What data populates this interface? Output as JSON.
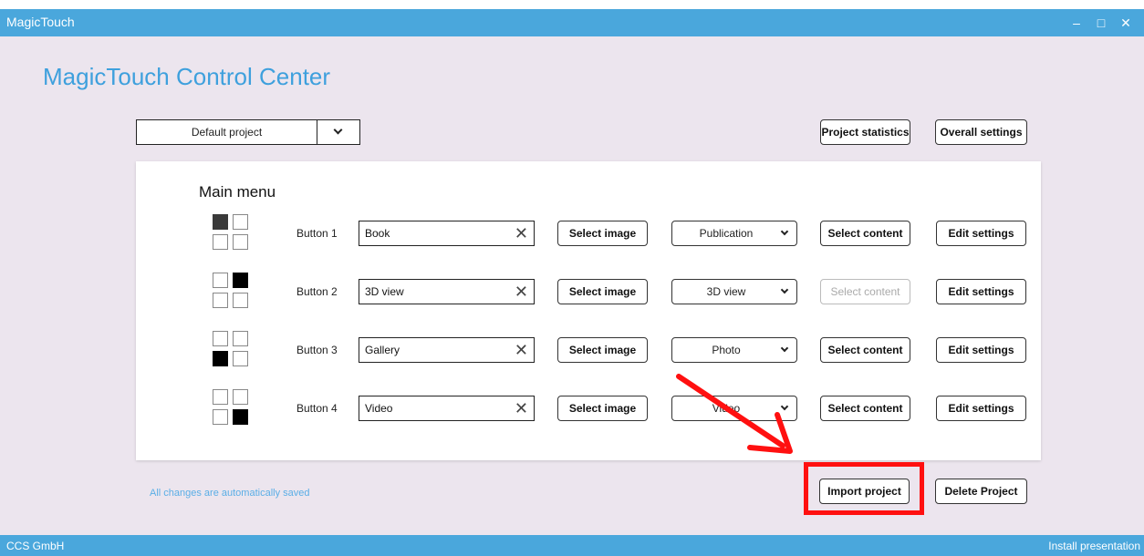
{
  "window": {
    "title": "MagicTouch",
    "controls": {
      "minimize": "–",
      "maximize": "□",
      "close": "✕"
    }
  },
  "heading": "MagicTouch Control Center",
  "project_select": {
    "value": "Default project",
    "icon": "chevron-down-icon"
  },
  "top_buttons": {
    "statistics": "Project statistics",
    "overall_settings": "Overall settings"
  },
  "panel": {
    "title": "Main menu",
    "rows": [
      {
        "label": "Button 1",
        "name": "Book",
        "select_image": "Select image",
        "type": "Publication",
        "select_content": "Select content",
        "select_content_enabled": true,
        "edit": "Edit settings",
        "clear_icon": "✕",
        "active_cell": "top-left"
      },
      {
        "label": "Button 2",
        "name": "3D view",
        "select_image": "Select image",
        "type": "3D view",
        "select_content": "Select content",
        "select_content_enabled": false,
        "edit": "Edit settings",
        "clear_icon": "✕",
        "active_cell": "top-right"
      },
      {
        "label": "Button 3",
        "name": "Gallery",
        "select_image": "Select image",
        "type": "Photo",
        "select_content": "Select content",
        "select_content_enabled": true,
        "edit": "Edit settings",
        "clear_icon": "✕",
        "active_cell": "bottom-left"
      },
      {
        "label": "Button 4",
        "name": "Video",
        "select_image": "Select image",
        "type": "Video",
        "select_content": "Select content",
        "select_content_enabled": true,
        "edit": "Edit settings",
        "clear_icon": "✕",
        "active_cell": "bottom-right"
      }
    ]
  },
  "footer": {
    "saved_note": "All changes are automatically saved",
    "import": "Import project",
    "delete": "Delete Project"
  },
  "statusbar": {
    "left": "CCS GmbH",
    "right": "Install presentation"
  },
  "colors": {
    "accent": "#4aa7dc",
    "heading": "#3ea0dd",
    "background": "#ece5ee",
    "annotation": "#ff1010"
  }
}
